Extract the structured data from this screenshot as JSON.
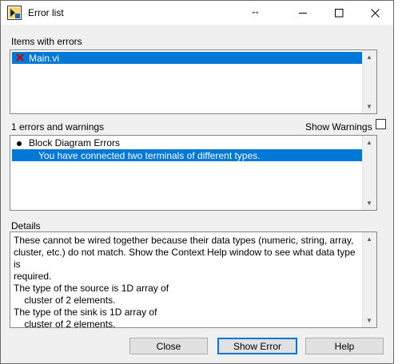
{
  "window": {
    "title": "Error list",
    "resize_glyph": "↔"
  },
  "icons": {
    "app": "labview-vi-icon",
    "error": "red-x-icon",
    "bullet": "bullet-icon"
  },
  "colors": {
    "selection": "#0078d7",
    "error_x": "#d40000"
  },
  "items_section": {
    "label": "Items with errors",
    "items": [
      {
        "name": "Main.vi",
        "selected": true
      }
    ]
  },
  "errors_section": {
    "count_label": "1 errors and warnings",
    "show_warnings_label": "Show Warnings",
    "show_warnings_checked": false,
    "group_label": "Block Diagram Errors",
    "error_message": "You have connected two terminals of different types."
  },
  "details_section": {
    "label": "Details",
    "text": "These cannot be wired together because their data types (numeric, string, array,\ncluster, etc.) do not match. Show the Context Help window to see what data type is\nrequired.\nThe type of the source is 1D array of\n    cluster of 2 elements.\nThe type of the sink is 1D array of\n    cluster of 2 elements."
  },
  "buttons": {
    "close": "Close",
    "show_error": "Show Error",
    "help": "Help"
  }
}
